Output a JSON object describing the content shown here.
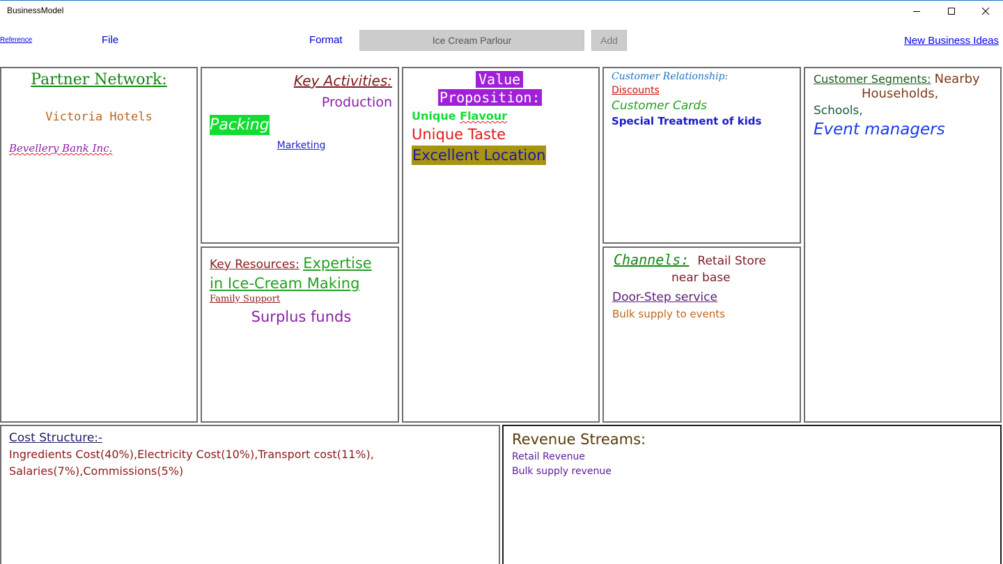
{
  "window": {
    "title": "BusinessModel"
  },
  "toolbar": {
    "reference_link": "Reference",
    "file_menu": "File",
    "format_menu": "Format",
    "model_name": "Ice Cream Parlour",
    "add_label": "Add",
    "new_ideas_link": "New Business Ideas"
  },
  "canvas": {
    "partner_network": {
      "heading": "Partner Network:",
      "items": [
        "Victoria Hotels",
        "Bevellery Bank Inc."
      ]
    },
    "key_activities": {
      "heading": "Key Activities:",
      "items": [
        "Production",
        "Packing",
        "Marketing"
      ]
    },
    "key_resources": {
      "heading": "Key Resources:",
      "line1": "Expertise",
      "line2": "in Ice-Cream Making",
      "line3": "Family Support",
      "line4": "Surplus funds"
    },
    "value_proposition": {
      "heading_line1": "Value",
      "heading_line2": "Proposition:",
      "item1_a": "Unique ",
      "item1_b": "Flavour",
      "item2": "Unique Taste",
      "item3": "Excellent Location"
    },
    "customer_relationship": {
      "heading": "Customer Relationship:",
      "items": [
        "Discounts",
        "Customer Cards",
        "Special Treatment of kids"
      ]
    },
    "channels": {
      "heading": "Channels:",
      "line1": "Retail Store",
      "line2": "near base",
      "items": [
        "Door-Step service",
        "Bulk supply to events"
      ]
    },
    "customer_segments": {
      "heading": "Customer Segments:",
      "line1": "Nearby",
      "line2": "Households,",
      "line3": "Schools,",
      "line4": "Event managers"
    },
    "cost_structure": {
      "heading": "Cost Structure:-",
      "line1": "Ingredients Cost(40%),Electricity Cost(10%),Transport cost(11%),",
      "line2": "Salaries(7%),Commissions(5%)"
    },
    "revenue_streams": {
      "heading": "Revenue Streams:",
      "items": [
        "Retail Revenue",
        "Bulk supply revenue"
      ]
    }
  },
  "colors": {
    "accent": "#1e70c1",
    "packing_highlight": "#11dd33",
    "value_heading_bg": "#a020d8",
    "location_highlight": "#a89410"
  }
}
